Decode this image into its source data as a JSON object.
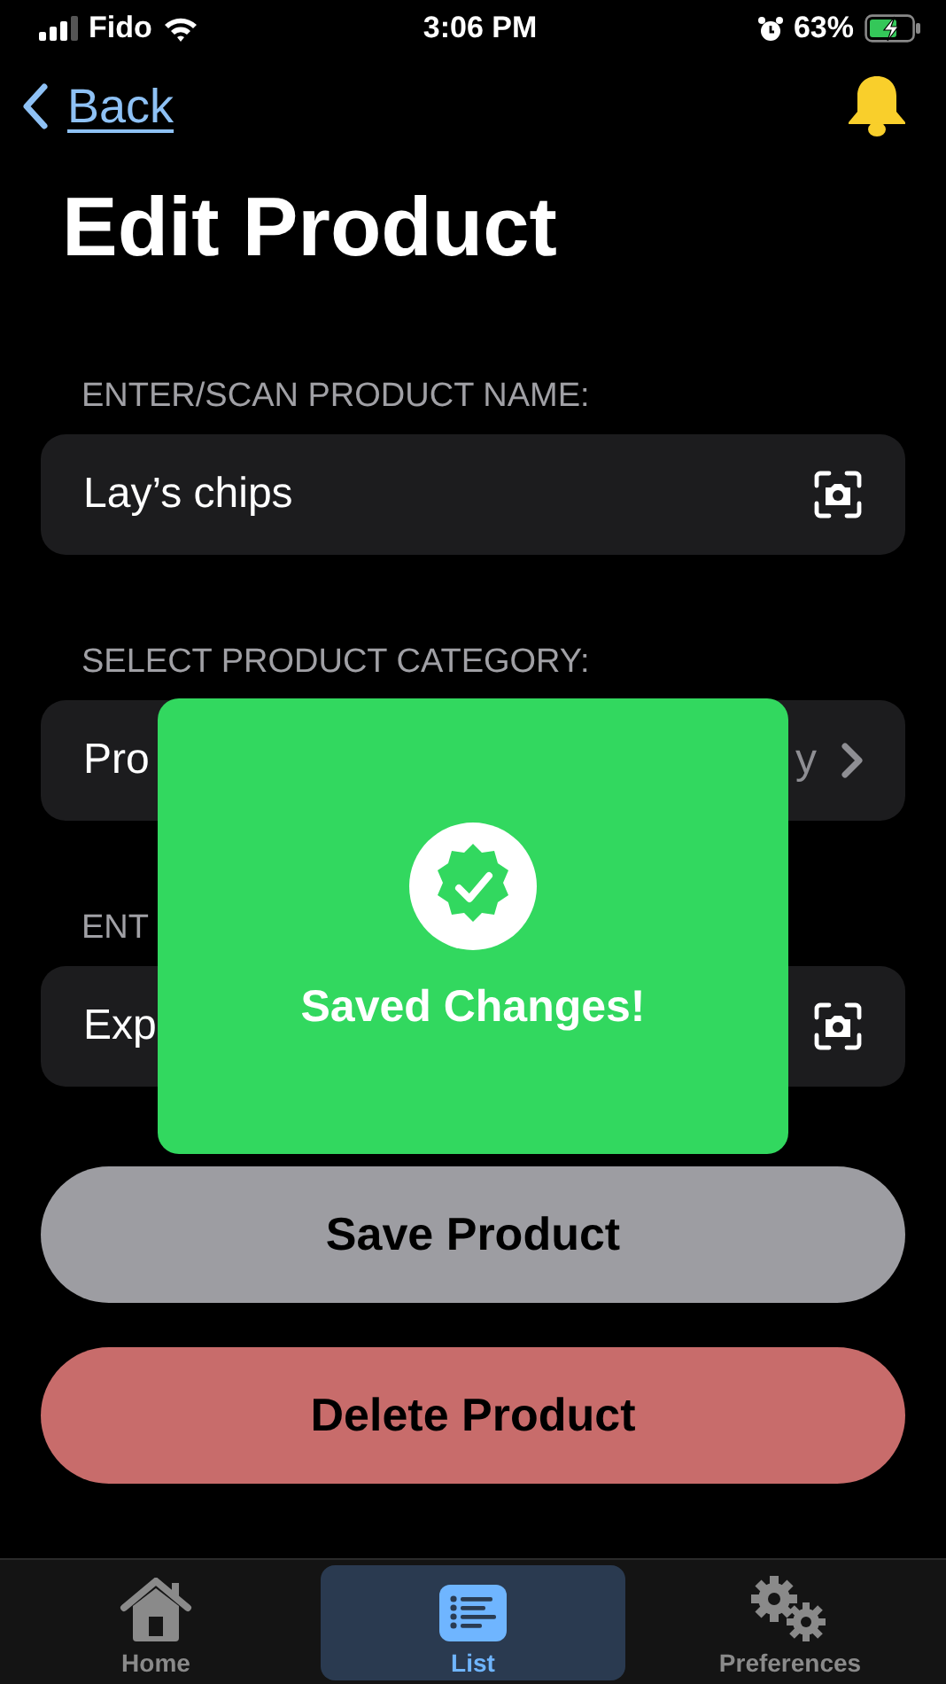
{
  "status_bar": {
    "carrier": "Fido",
    "time": "3:06 PM",
    "battery": "63%"
  },
  "nav": {
    "back": "Back",
    "title": "Edit Product"
  },
  "fields": [
    {
      "label": "ENTER/SCAN PRODUCT NAME:",
      "value": "Lay’s chips",
      "kind": "scan"
    },
    {
      "label": "SELECT PRODUCT CATEGORY:",
      "value": "Pro",
      "value_tail": "y",
      "kind": "picker"
    },
    {
      "label": "ENT",
      "value": "Exp",
      "kind": "scan"
    }
  ],
  "buttons": [
    {
      "label": "Save Product",
      "kind": "save"
    },
    {
      "label": "Delete Product",
      "kind": "delete"
    }
  ],
  "toast": {
    "message": "Saved Changes!"
  },
  "tabs": [
    {
      "label": "Home",
      "kind": "home",
      "selected": false
    },
    {
      "label": "List",
      "kind": "list",
      "selected": true
    },
    {
      "label": "Preferences",
      "kind": "preferences",
      "selected": false
    }
  ]
}
